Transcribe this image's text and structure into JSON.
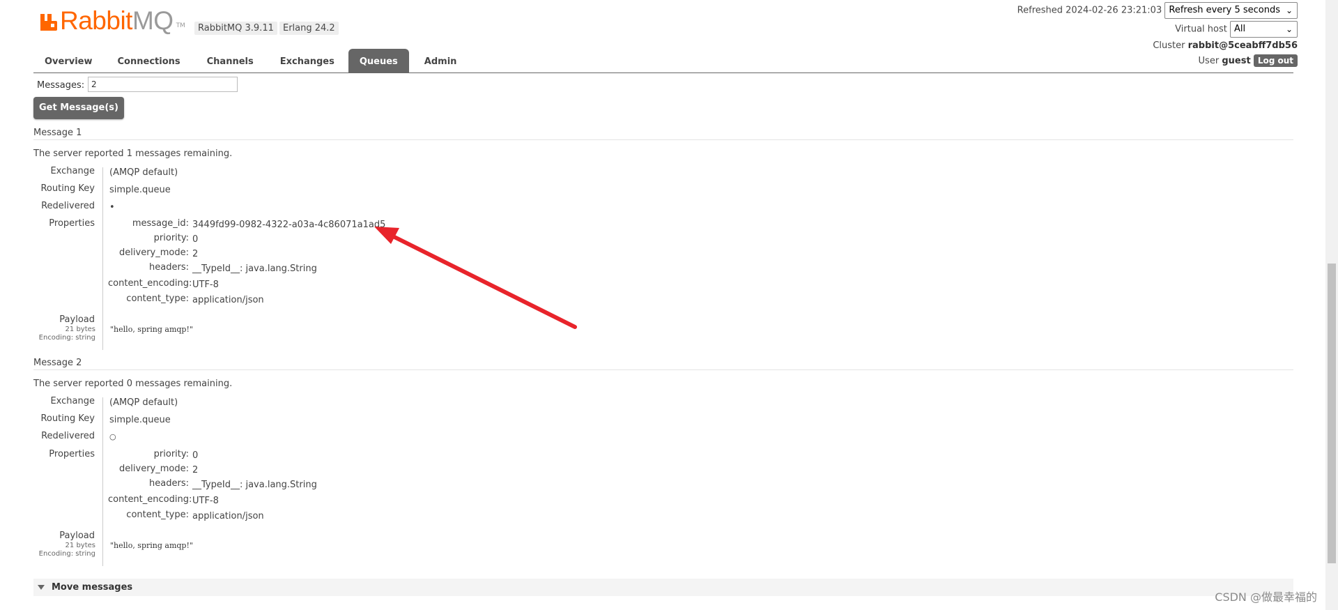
{
  "header": {
    "logo_rabbit": "Rabbit",
    "logo_mq": "MQ",
    "logo_tm": "TM",
    "version": "RabbitMQ 3.9.11",
    "erlang": "Erlang 24.2",
    "refreshed_label": "Refreshed",
    "refreshed_time": "2024-02-26 23:21:03",
    "refresh_select": "Refresh every 5 seconds",
    "vhost_label": "Virtual host",
    "vhost_select": "All",
    "cluster_label": "Cluster",
    "cluster_name": "rabbit@5ceabff7db56",
    "user_label": "User",
    "user_name": "guest",
    "logout_label": "Log out"
  },
  "tabs": [
    "Overview",
    "Connections",
    "Channels",
    "Exchanges",
    "Queues",
    "Admin"
  ],
  "active_tab": "Queues",
  "get_form": {
    "messages_label": "Messages:",
    "messages_value": "2",
    "get_button": "Get Message(s)"
  },
  "labels": {
    "exchange": "Exchange",
    "routing_key": "Routing Key",
    "redelivered": "Redelivered",
    "properties": "Properties",
    "payload": "Payload",
    "encoding": "Encoding: string"
  },
  "messages": [
    {
      "title": "Message 1",
      "remaining_prefix": "The server reported",
      "remaining_count": "1",
      "remaining_suffix": "messages remaining.",
      "exchange": "(AMQP default)",
      "routing_key": "simple.queue",
      "redelivered": "•",
      "props": {
        "message_id": "3449fd99-0982-4322-a03a-4c86071a1ad5",
        "priority": "0",
        "delivery_mode": "2",
        "headers_key": "__TypeId__:",
        "headers_val": "java.lang.String",
        "content_encoding": "UTF-8",
        "content_type": "application/json"
      },
      "payload_size": "21 bytes",
      "payload": "\"hello, spring amqp!\""
    },
    {
      "title": "Message 2",
      "remaining_prefix": "The server reported",
      "remaining_count": "0",
      "remaining_suffix": "messages remaining.",
      "exchange": "(AMQP default)",
      "routing_key": "simple.queue",
      "redelivered": "○",
      "props": {
        "priority": "0",
        "delivery_mode": "2",
        "headers_key": "__TypeId__:",
        "headers_val": "java.lang.String",
        "content_encoding": "UTF-8",
        "content_type": "application/json"
      },
      "payload_size": "21 bytes",
      "payload": "\"hello, spring amqp!\""
    }
  ],
  "prop_keys": {
    "message_id": "message_id:",
    "priority": "priority:",
    "delivery_mode": "delivery_mode:",
    "headers": "headers:",
    "content_encoding": "content_encoding:",
    "content_type": "content_type:"
  },
  "move_messages": "Move messages",
  "watermark": "CSDN @做最幸福的",
  "colors": {
    "accent": "#ff6600",
    "tab_active": "#666666",
    "arrow": "#e8242b"
  }
}
